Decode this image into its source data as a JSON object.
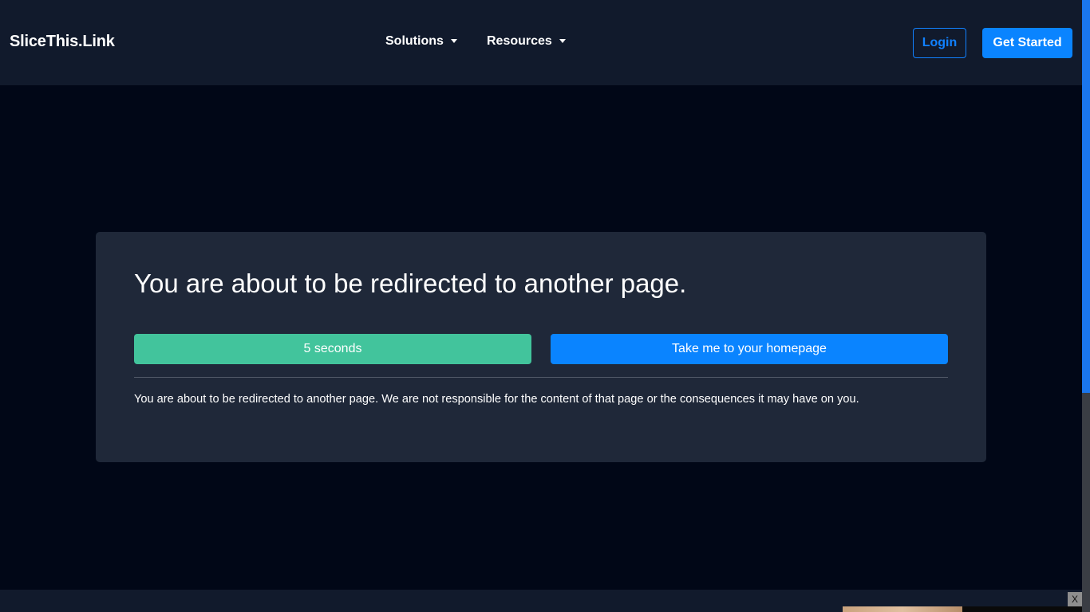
{
  "header": {
    "brand": "SliceThis.Link",
    "nav": [
      {
        "label": "Solutions"
      },
      {
        "label": "Resources"
      }
    ],
    "login_label": "Login",
    "get_started_label": "Get Started"
  },
  "card": {
    "title": "You are about to be redirected to another page.",
    "countdown_label": "5 seconds",
    "home_button_label": "Take me to your homepage",
    "disclaimer": "You are about to be redirected to another page. We are not responsible for the content of that page or the consequences it may have on you."
  },
  "ad": {
    "close_label": "X"
  },
  "colors": {
    "page_bg": "#010717",
    "navbar_bg": "#111a2c",
    "card_bg": "#1f2839",
    "primary": "#0a84ff",
    "countdown": "#42c49c"
  }
}
